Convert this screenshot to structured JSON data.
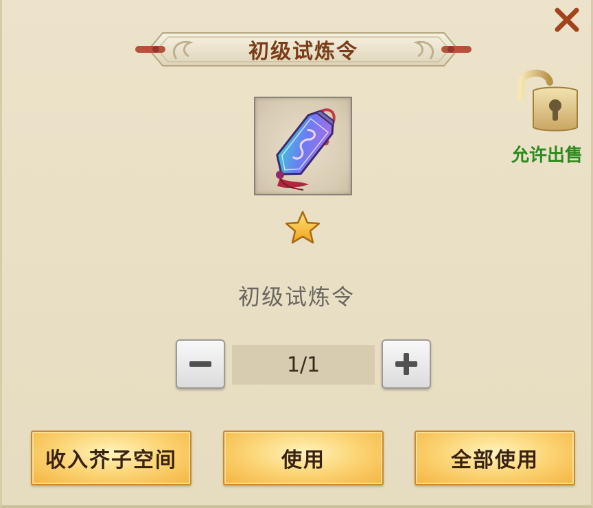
{
  "dialog": {
    "title": "初级试炼令",
    "item_name": "初级试炼令",
    "sell_status": "允许出售",
    "quantity": "1/1",
    "star_count": 1
  },
  "actions": {
    "store": "收入芥子空间",
    "use": "使用",
    "use_all": "全部使用"
  },
  "colors": {
    "title": "#7a3d18",
    "sell_status": "#2e8a1e",
    "button_gold": "#fcd77a",
    "close": "#a3431c"
  },
  "icons": {
    "close": "close-icon",
    "lock": "unlocked-padlock-icon",
    "item": "trial-token-icon",
    "star": "star-icon",
    "minus": "minus-icon",
    "plus": "plus-icon"
  }
}
